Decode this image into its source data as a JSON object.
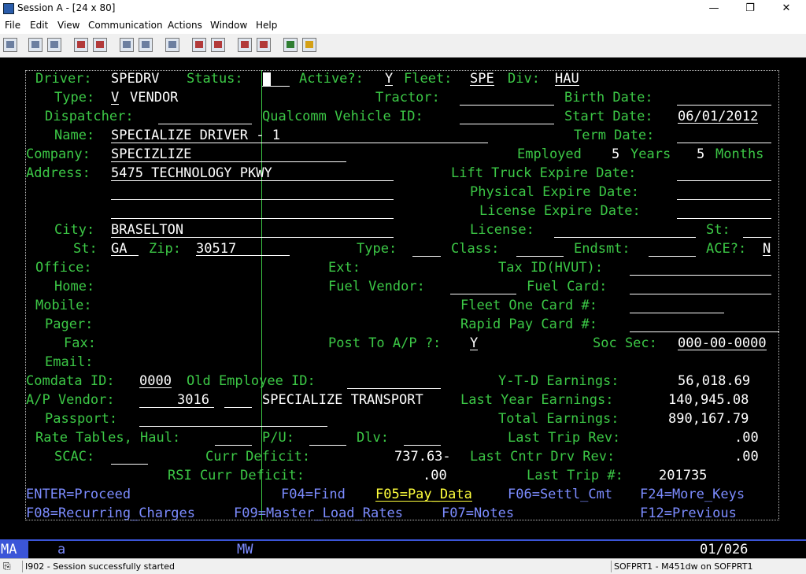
{
  "window": {
    "title": "Session A - [24 x 80]",
    "minimize": "—",
    "restore": "❐",
    "close": "✕"
  },
  "menu": [
    "File",
    "Edit",
    "View",
    "Communication",
    "Actions",
    "Window",
    "Help"
  ],
  "screen": {
    "driver_label": "Driver:",
    "driver": "SPEDRV",
    "status_label": "Status:",
    "active_label": "Active?:",
    "active": "Y",
    "fleet_label": "Fleet:",
    "fleet": "SPE",
    "div_label": "Div:",
    "div": "HAU",
    "type_label": "Type:",
    "type_code": "V",
    "type_desc": "VENDOR",
    "tractor_label": "Tractor:",
    "birth_date_label": "Birth Date:",
    "dispatcher_label": "Dispatcher:",
    "qualcomm_label": "Qualcomm Vehicle ID:",
    "start_date_label": "Start Date:",
    "start_date": "06/01/2012",
    "name_label": "Name:",
    "name": "SPECIALIZE DRIVER - 1",
    "term_date_label": "Term Date:",
    "company_label": "Company:",
    "company": "SPECIZLIZE",
    "employed_label": "Employed",
    "employed_years": "5",
    "years_label": "Years",
    "employed_months": "5",
    "months_label": "Months",
    "address_label": "Address:",
    "address1": "5475 TECHNOLOGY PKWY",
    "lift_truck_label": "Lift Truck Expire Date:",
    "physical_label": "Physical Expire Date:",
    "license_expire_label": "License Expire Date:",
    "city_label": "City:",
    "city": "BRASELTON",
    "license_label": "License:",
    "st_label": "St:",
    "st2_label": "St:",
    "state": "GA",
    "zip_label": "Zip:",
    "zip": "30517",
    "type2_label": "Type:",
    "class_label": "Class:",
    "endsmt_label": "Endsmt:",
    "ace_label": "ACE?:",
    "ace": "N",
    "office_label": "Office:",
    "ext_label": "Ext:",
    "taxid_label": "Tax ID(HVUT):",
    "home_label": "Home:",
    "fuel_vendor_label": "Fuel Vendor:",
    "fuel_card_label": "Fuel Card:",
    "mobile_label": "Mobile:",
    "fleet_one_label": "Fleet One Card #:",
    "pager_label": "Pager:",
    "rapid_pay_label": "Rapid Pay Card #:",
    "fax_label": "Fax:",
    "post_ap_label": "Post To A/P ?:",
    "post_ap": "Y",
    "soc_sec_label": "Soc Sec:",
    "soc_sec": "000-00-0000",
    "email_label": "Email:",
    "comdata_label": "Comdata ID:",
    "comdata": "0000",
    "old_emp_label": "Old Employee ID:",
    "ytd_label": "Y-T-D Earnings:",
    "ytd": "56,018.69",
    "ap_vendor_label": "A/P Vendor:",
    "ap_vendor": "3016",
    "ap_vendor_name": "SPECIALIZE TRANSPORT",
    "last_year_label": "Last Year Earnings:",
    "last_year": "140,945.08",
    "passport_label": "Passport:",
    "total_label": "Total Earnings:",
    "total": "890,167.79",
    "rate_tables_label": "Rate Tables, Haul:",
    "pu_label": "P/U:",
    "dlv_label": "Dlv:",
    "last_trip_rev_label": "Last Trip Rev:",
    "last_trip_rev": ".00",
    "scac_label": "SCAC:",
    "curr_deficit_label": "Curr Deficit:",
    "curr_deficit": "737.63-",
    "last_cntr_label": "Last Cntr Drv Rev:",
    "last_cntr": ".00",
    "rsi_label": "RSI Curr Deficit:",
    "rsi": ".00",
    "last_trip_num_label": "Last Trip #:",
    "last_trip_num": "201735",
    "fkeys_row1": [
      "ENTER=Proceed",
      "F04=Find",
      "F05=Pay_Data",
      "F06=Settl_Cmt",
      "F24=More_Keys"
    ],
    "fkeys_row2": [
      "F08=Recurring_Charges",
      "F09=Master_Load_Rates",
      "F07=Notes",
      "F12=Previous"
    ]
  },
  "oia": {
    "mode": "MA",
    "a": "a",
    "mw": "MW",
    "pos": "01/026"
  },
  "status": {
    "message": "I902 - Session successfully started",
    "right": "SOFPRT1 - M451dw on SOFPRT1"
  }
}
